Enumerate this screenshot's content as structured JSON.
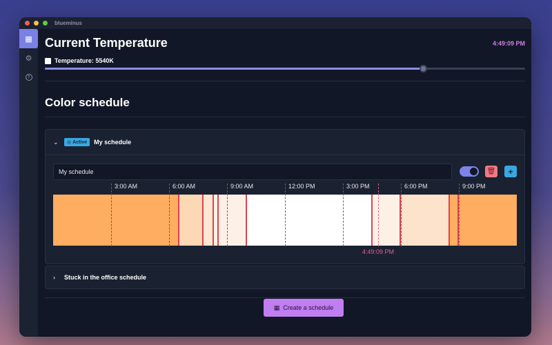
{
  "app": {
    "title": "blueminus"
  },
  "sidebar": {
    "items": [
      {
        "name": "calendar",
        "icon": "calendar-icon",
        "glyph": "▦"
      },
      {
        "name": "settings",
        "icon": "gear-icon",
        "glyph": "⚙"
      },
      {
        "name": "help",
        "icon": "help-icon",
        "glyph": "?"
      }
    ]
  },
  "header": {
    "title": "Current Temperature",
    "clock": "4:49:09 PM",
    "temperature_label": "Temperature: 5540K",
    "slider_fraction": 0.787
  },
  "schedule": {
    "title": "Color schedule",
    "schedules": [
      {
        "name": "My schedule",
        "badge": "Active",
        "expanded": true,
        "input_value": "My schedule"
      },
      {
        "name": "Stuck in the office schedule",
        "expanded": false
      }
    ],
    "create_button": "Create a schedule"
  },
  "timeline": {
    "ticks": [
      "3:00 AM",
      "6:00 AM",
      "9:00 AM",
      "12:00 PM",
      "3:00 PM",
      "6:00 PM",
      "9:00 PM"
    ],
    "tick_hours": [
      3,
      6,
      9,
      12,
      15,
      18,
      21
    ],
    "now_label": "4:49:09 PM",
    "now_hour": 16.819,
    "segments": [
      {
        "from_hour": 0,
        "to_hour": 6.5,
        "color": "#ffad60"
      },
      {
        "from_hour": 6.5,
        "to_hour": 7.75,
        "color": "#fdd8b5"
      },
      {
        "from_hour": 7.75,
        "to_hour": 8.3,
        "color": "#fde7d2"
      },
      {
        "from_hour": 8.3,
        "to_hour": 8.55,
        "color": "#fdf0e4"
      },
      {
        "from_hour": 8.55,
        "to_hour": 10.0,
        "color": "#fdf1e6"
      },
      {
        "from_hour": 10.0,
        "to_hour": 16.5,
        "color": "#ffffff"
      },
      {
        "from_hour": 16.5,
        "to_hour": 17.95,
        "color": "#fdf1e6"
      },
      {
        "from_hour": 17.95,
        "to_hour": 20.5,
        "color": "#fde3cb"
      },
      {
        "from_hour": 20.5,
        "to_hour": 24,
        "color": "#ffad60"
      }
    ],
    "markers_hours": [
      6.5,
      7.75,
      8.3,
      8.55,
      10.0,
      16.5,
      17.95,
      20.5,
      20.95
    ]
  },
  "colors": {
    "accent": "#7d83ea",
    "clock": "#d27ee0",
    "active_badge": "#3aa7e0",
    "danger": "#f07a83",
    "create": "#c07ef0",
    "marker": "#e0424f"
  }
}
